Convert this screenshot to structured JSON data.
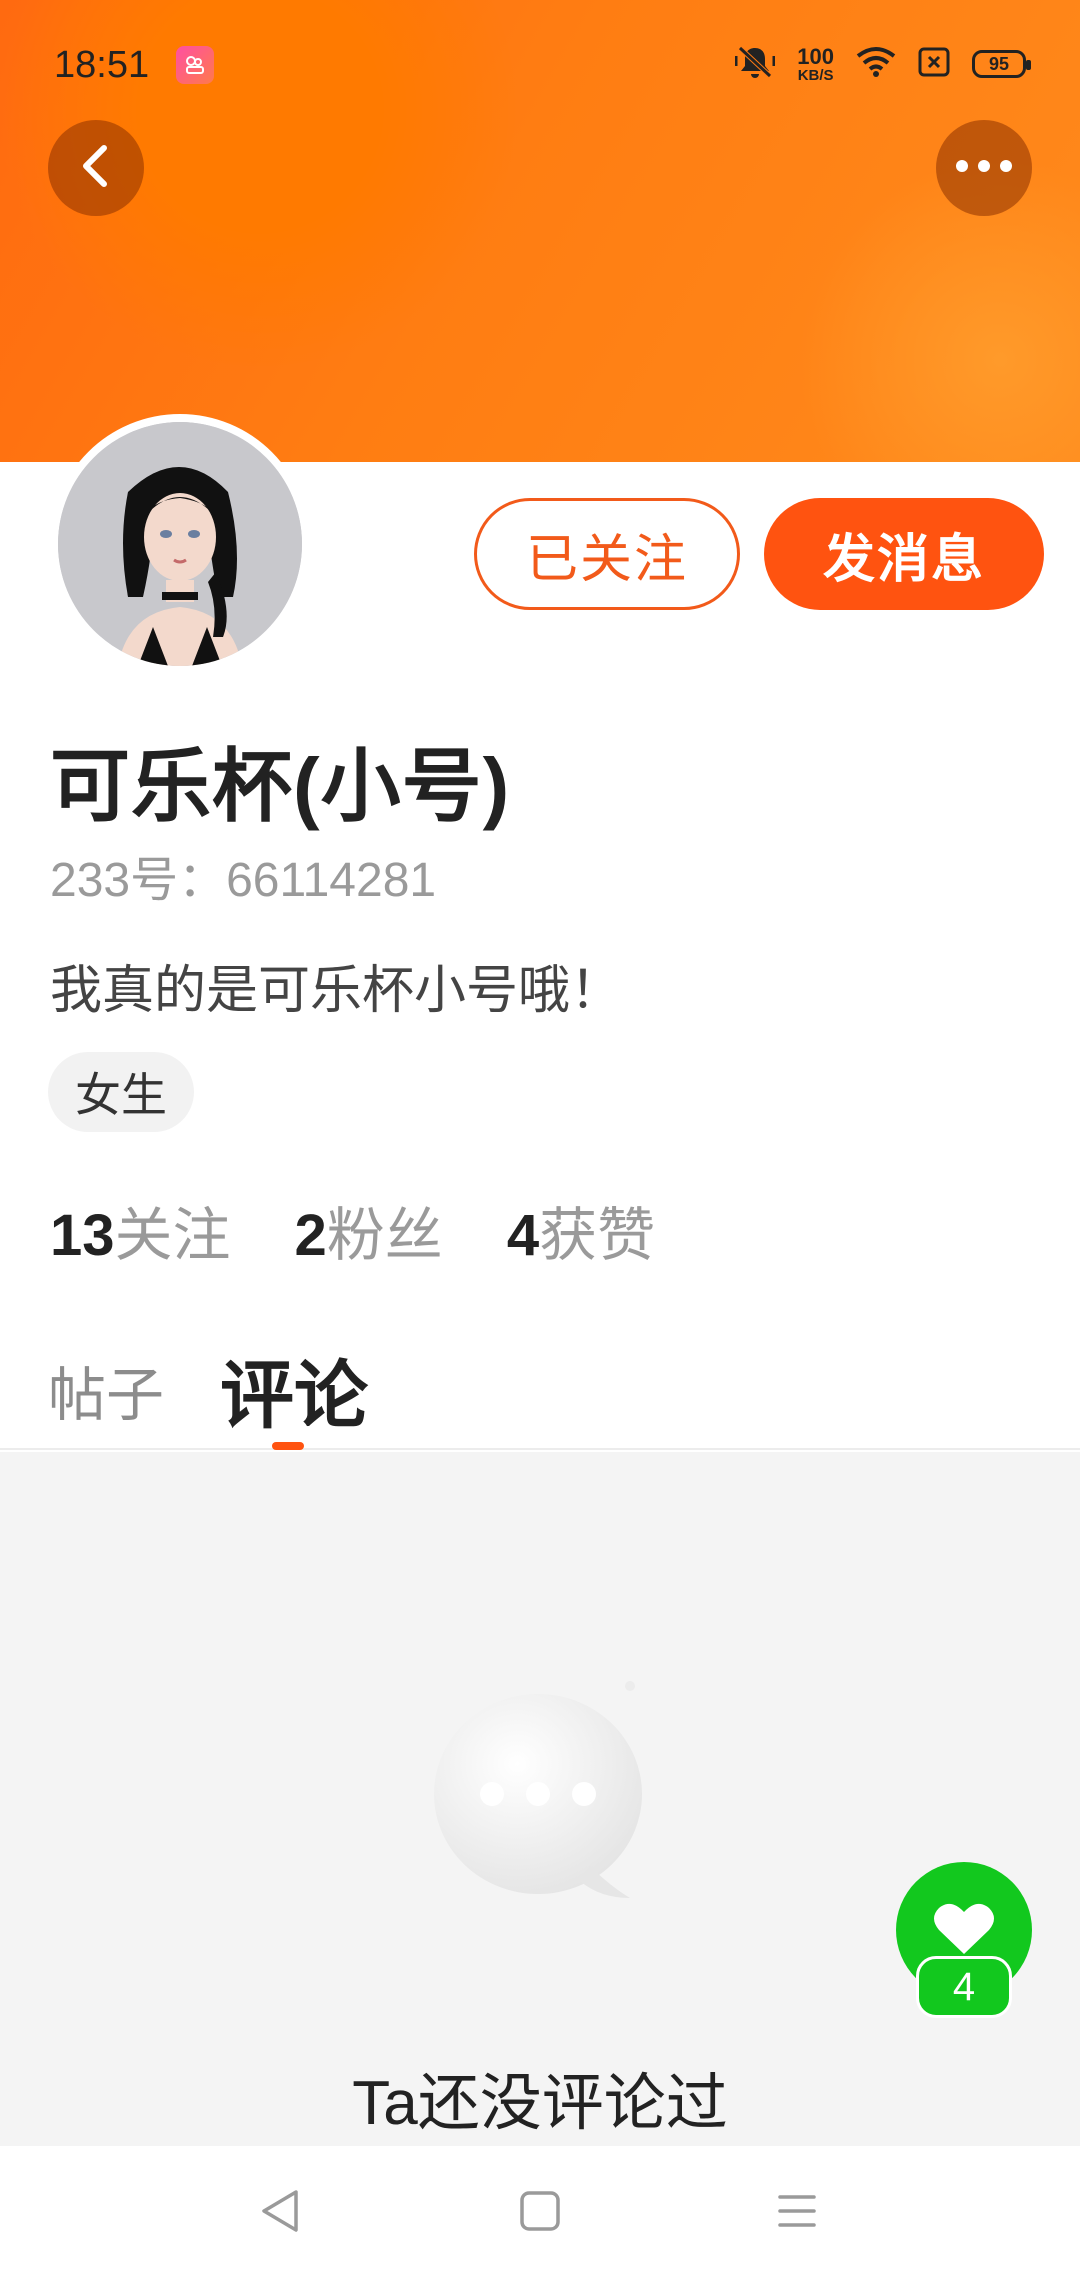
{
  "status_bar": {
    "time": "18:51",
    "net_speed_value": "100",
    "net_speed_unit": "KB/S",
    "battery": "95"
  },
  "profile": {
    "username": "可乐杯(小号)",
    "user_id": "233号：66114281",
    "bio": "我真的是可乐杯小号哦！",
    "tag": "女生",
    "followed_label": "已关注",
    "message_label": "发消息"
  },
  "stats": {
    "following_count": "13",
    "following_label": "关注",
    "fans_count": "2",
    "fans_label": "粉丝",
    "likes_count": "4",
    "likes_label": "获赞"
  },
  "tabs": {
    "posts": "帖子",
    "comments": "评论"
  },
  "empty_state": {
    "text": "Ta还没评论过"
  },
  "like_fab": {
    "count": "4"
  },
  "colors": {
    "accent": "#ff5310",
    "banner": "#ff7a12",
    "like_green": "#12c81e"
  }
}
